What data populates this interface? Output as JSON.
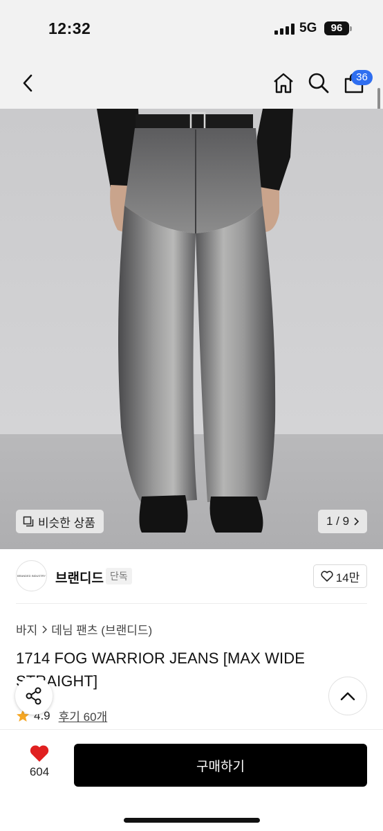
{
  "status_bar": {
    "time": "12:32",
    "network": "5G",
    "battery": "96"
  },
  "nav": {
    "back_icon": "chevron-left-icon",
    "home_icon": "home-icon",
    "search_icon": "search-icon",
    "cart_icon": "bag-icon",
    "cart_badge": "36",
    "badge_color": "#2f6ef0"
  },
  "hero": {
    "image": "wide-leg-gray-washed-jeans-photo",
    "similar_label": "비슷한 상품",
    "counter": "1 / 9"
  },
  "seller": {
    "logo_text": "BRANDED INDUSTRY",
    "name": "브랜디드",
    "tag": "단독",
    "likes": "14만"
  },
  "product": {
    "breadcrumb": [
      "바지",
      "데님 팬츠 (브랜디드)"
    ],
    "title": "1714 FOG WARRIOR JEANS [MAX WIDE STRAIGHT]",
    "rating": "4.9",
    "reviews": "후기 60개",
    "star_color": "#f5a623"
  },
  "bottom_bar": {
    "wish_count": "604",
    "heart_color": "#e02020",
    "buy_label": "구매하기"
  }
}
